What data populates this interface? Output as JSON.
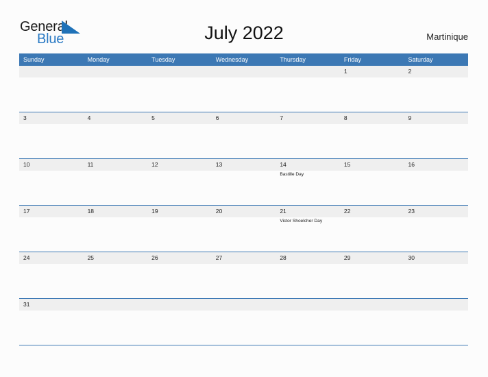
{
  "brand": {
    "name_part1": "General",
    "name_part2": "Blue",
    "flag_icon": "blue-flag-triangle",
    "color_dark": "#1a1a1a",
    "color_blue": "#2a7ac4"
  },
  "header": {
    "title": "July 2022",
    "region": "Martinique"
  },
  "theme": {
    "header_blue": "#3c78b4",
    "date_band_gray": "#efefef",
    "page_background": "#fcfcfc",
    "text_dark": "#222222"
  },
  "calendar": {
    "month": "July",
    "year": "2022",
    "weekday_headers": [
      "Sunday",
      "Monday",
      "Tuesday",
      "Wednesday",
      "Thursday",
      "Friday",
      "Saturday"
    ],
    "weeks": [
      {
        "days": [
          {
            "number": "",
            "events": []
          },
          {
            "number": "",
            "events": []
          },
          {
            "number": "",
            "events": []
          },
          {
            "number": "",
            "events": []
          },
          {
            "number": "",
            "events": []
          },
          {
            "number": "1",
            "events": []
          },
          {
            "number": "2",
            "events": []
          }
        ]
      },
      {
        "days": [
          {
            "number": "3",
            "events": []
          },
          {
            "number": "4",
            "events": []
          },
          {
            "number": "5",
            "events": []
          },
          {
            "number": "6",
            "events": []
          },
          {
            "number": "7",
            "events": []
          },
          {
            "number": "8",
            "events": []
          },
          {
            "number": "9",
            "events": []
          }
        ]
      },
      {
        "days": [
          {
            "number": "10",
            "events": []
          },
          {
            "number": "11",
            "events": []
          },
          {
            "number": "12",
            "events": []
          },
          {
            "number": "13",
            "events": []
          },
          {
            "number": "14",
            "events": [
              "Bastille Day"
            ]
          },
          {
            "number": "15",
            "events": []
          },
          {
            "number": "16",
            "events": []
          }
        ]
      },
      {
        "days": [
          {
            "number": "17",
            "events": []
          },
          {
            "number": "18",
            "events": []
          },
          {
            "number": "19",
            "events": []
          },
          {
            "number": "20",
            "events": []
          },
          {
            "number": "21",
            "events": [
              "Victor Shoelcher Day"
            ]
          },
          {
            "number": "22",
            "events": []
          },
          {
            "number": "23",
            "events": []
          }
        ]
      },
      {
        "days": [
          {
            "number": "24",
            "events": []
          },
          {
            "number": "25",
            "events": []
          },
          {
            "number": "26",
            "events": []
          },
          {
            "number": "27",
            "events": []
          },
          {
            "number": "28",
            "events": []
          },
          {
            "number": "29",
            "events": []
          },
          {
            "number": "30",
            "events": []
          }
        ]
      },
      {
        "days": [
          {
            "number": "31",
            "events": []
          },
          {
            "number": "",
            "events": []
          },
          {
            "number": "",
            "events": []
          },
          {
            "number": "",
            "events": []
          },
          {
            "number": "",
            "events": []
          },
          {
            "number": "",
            "events": []
          },
          {
            "number": "",
            "events": []
          }
        ]
      }
    ]
  }
}
